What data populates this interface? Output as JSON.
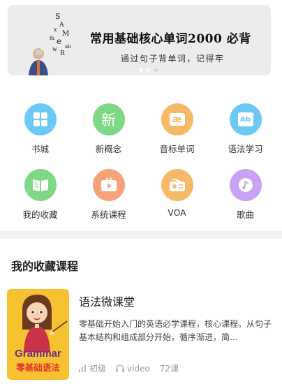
{
  "banner": {
    "title": "常用基础核心单词2000 必背",
    "subtitle": "通过句子背单词，记得牢",
    "slides": 3,
    "active_slide": 3
  },
  "grid": [
    {
      "label": "书城",
      "icon": "grid-apps-icon",
      "color": "#6cc8f4"
    },
    {
      "label": "新概念",
      "icon": "xin-text-icon",
      "glyph": "新",
      "color": "#7fd886"
    },
    {
      "label": "音标单词",
      "icon": "phonetic-ae-icon",
      "glyph": "æ",
      "color": "#f7b968"
    },
    {
      "label": "语法学习",
      "icon": "ab-book-icon",
      "glyph": "Ab",
      "color": "#6cc8f4"
    },
    {
      "label": "我的收藏",
      "icon": "open-book-icon",
      "color": "#7fd886"
    },
    {
      "label": "系统课程",
      "icon": "video-play-icon",
      "color": "#f8a27a"
    },
    {
      "label": "VOA",
      "icon": "radio-icon",
      "color": "#f7b968"
    },
    {
      "label": "歌曲",
      "icon": "music-disc-icon",
      "color": "#c9a3f3"
    }
  ],
  "section": {
    "title": "我的收藏课程"
  },
  "course": {
    "title": "语法微课堂",
    "description": "零基础开始入门的英语必学课程，核心课程。从句子基本结构和组成部分开始，循序渐进，简…",
    "cover_en": "Grammar",
    "cover_cn": "零基础语法",
    "level": "初级",
    "media": "video",
    "lessons": "72课"
  }
}
